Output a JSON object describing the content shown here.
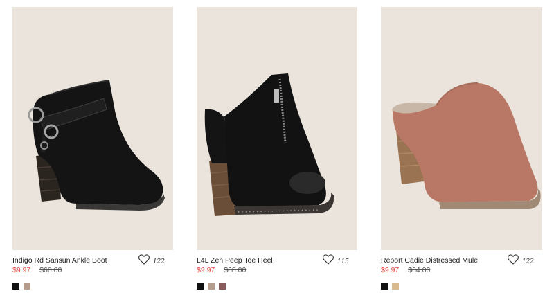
{
  "products": [
    {
      "name": "Indigo Rd Sansun Ankle Boot",
      "sale_price": "$9.97",
      "original_price": "$68.00",
      "wishlist_count": "122",
      "swatches": [
        "#111111",
        "#b49d8c"
      ]
    },
    {
      "name": "L4L Zen Peep Toe Heel",
      "sale_price": "$9.97",
      "original_price": "$68.00",
      "wishlist_count": "115",
      "swatches": [
        "#111111",
        "#b49d8c",
        "#8a5b5c"
      ]
    },
    {
      "name": "Report Cadie Distressed Mule",
      "sale_price": "$9.97",
      "original_price": "$64.00",
      "wishlist_count": "122",
      "swatches": [
        "#111111",
        "#d9b98e"
      ]
    }
  ],
  "colors": {
    "sale": "#e4463c",
    "photo_background": "#ebe4dd"
  }
}
